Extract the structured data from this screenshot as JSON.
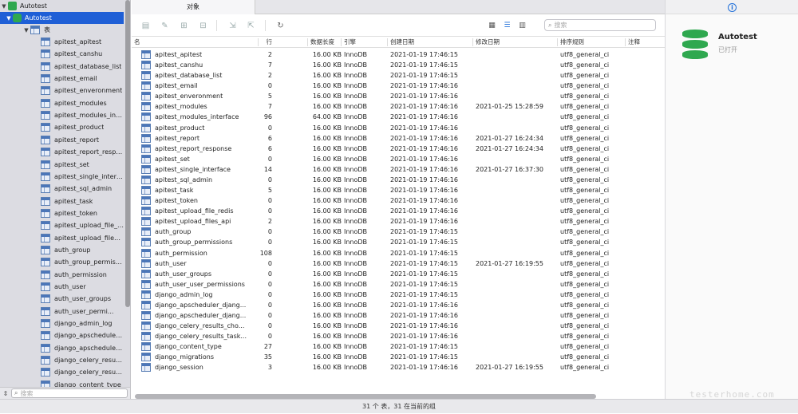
{
  "sidebar": {
    "connection": "Autotest",
    "database": "Autotest",
    "group": "表",
    "tables": [
      "apitest_apitest",
      "apitest_canshu",
      "apitest_database_list",
      "apitest_email",
      "apitest_enveronment",
      "apitest_modules",
      "apitest_modules_inter...",
      "apitest_product",
      "apitest_report",
      "apitest_report_response",
      "apitest_set",
      "apitest_single_interface",
      "apitest_sql_admin",
      "apitest_task",
      "apitest_token",
      "apitest_upload_file_re...",
      "apitest_upload_files_api",
      "auth_group",
      "auth_group_permissio...",
      "auth_permission",
      "auth_user",
      "auth_user_groups",
      "auth_user_permi...",
      "django_admin_log",
      "django_apscheduler_d...",
      "django_apscheduler_d...",
      "django_celery_results_...",
      "django_celery_results_...",
      "django_content_type"
    ],
    "search_placeholder": "搜索"
  },
  "tab": {
    "label": "对象"
  },
  "toolbar": {
    "search_placeholder": "搜索"
  },
  "columns": {
    "name": "名",
    "rows": "行",
    "size": "数据长度",
    "engine": "引擎",
    "created": "创建日期",
    "modified": "修改日期",
    "collation": "排序规则",
    "comment": "注释"
  },
  "rows": [
    {
      "name": "apitest_apitest",
      "rows": "2",
      "size": "16.00 KB",
      "engine": "InnoDB",
      "created": "2021-01-19 17:46:15",
      "modified": "",
      "collation": "utf8_general_ci"
    },
    {
      "name": "apitest_canshu",
      "rows": "7",
      "size": "16.00 KB",
      "engine": "InnoDB",
      "created": "2021-01-19 17:46:15",
      "modified": "",
      "collation": "utf8_general_ci"
    },
    {
      "name": "apitest_database_list",
      "rows": "2",
      "size": "16.00 KB",
      "engine": "InnoDB",
      "created": "2021-01-19 17:46:15",
      "modified": "",
      "collation": "utf8_general_ci"
    },
    {
      "name": "apitest_email",
      "rows": "0",
      "size": "16.00 KB",
      "engine": "InnoDB",
      "created": "2021-01-19 17:46:16",
      "modified": "",
      "collation": "utf8_general_ci"
    },
    {
      "name": "apitest_enveronment",
      "rows": "5",
      "size": "16.00 KB",
      "engine": "InnoDB",
      "created": "2021-01-19 17:46:16",
      "modified": "",
      "collation": "utf8_general_ci"
    },
    {
      "name": "apitest_modules",
      "rows": "7",
      "size": "16.00 KB",
      "engine": "InnoDB",
      "created": "2021-01-19 17:46:16",
      "modified": "2021-01-25 15:28:59",
      "collation": "utf8_general_ci"
    },
    {
      "name": "apitest_modules_interface",
      "rows": "96",
      "size": "64.00 KB",
      "engine": "InnoDB",
      "created": "2021-01-19 17:46:16",
      "modified": "",
      "collation": "utf8_general_ci"
    },
    {
      "name": "apitest_product",
      "rows": "0",
      "size": "16.00 KB",
      "engine": "InnoDB",
      "created": "2021-01-19 17:46:16",
      "modified": "",
      "collation": "utf8_general_ci"
    },
    {
      "name": "apitest_report",
      "rows": "6",
      "size": "16.00 KB",
      "engine": "InnoDB",
      "created": "2021-01-19 17:46:16",
      "modified": "2021-01-27 16:24:34",
      "collation": "utf8_general_ci"
    },
    {
      "name": "apitest_report_response",
      "rows": "6",
      "size": "16.00 KB",
      "engine": "InnoDB",
      "created": "2021-01-19 17:46:16",
      "modified": "2021-01-27 16:24:34",
      "collation": "utf8_general_ci"
    },
    {
      "name": "apitest_set",
      "rows": "0",
      "size": "16.00 KB",
      "engine": "InnoDB",
      "created": "2021-01-19 17:46:16",
      "modified": "",
      "collation": "utf8_general_ci"
    },
    {
      "name": "apitest_single_interface",
      "rows": "14",
      "size": "16.00 KB",
      "engine": "InnoDB",
      "created": "2021-01-19 17:46:16",
      "modified": "2021-01-27 16:37:30",
      "collation": "utf8_general_ci"
    },
    {
      "name": "apitest_sql_admin",
      "rows": "0",
      "size": "16.00 KB",
      "engine": "InnoDB",
      "created": "2021-01-19 17:46:16",
      "modified": "",
      "collation": "utf8_general_ci"
    },
    {
      "name": "apitest_task",
      "rows": "5",
      "size": "16.00 KB",
      "engine": "InnoDB",
      "created": "2021-01-19 17:46:16",
      "modified": "",
      "collation": "utf8_general_ci"
    },
    {
      "name": "apitest_token",
      "rows": "0",
      "size": "16.00 KB",
      "engine": "InnoDB",
      "created": "2021-01-19 17:46:16",
      "modified": "",
      "collation": "utf8_general_ci"
    },
    {
      "name": "apitest_upload_file_redis",
      "rows": "0",
      "size": "16.00 KB",
      "engine": "InnoDB",
      "created": "2021-01-19 17:46:16",
      "modified": "",
      "collation": "utf8_general_ci"
    },
    {
      "name": "apitest_upload_files_api",
      "rows": "2",
      "size": "16.00 KB",
      "engine": "InnoDB",
      "created": "2021-01-19 17:46:16",
      "modified": "",
      "collation": "utf8_general_ci"
    },
    {
      "name": "auth_group",
      "rows": "0",
      "size": "16.00 KB",
      "engine": "InnoDB",
      "created": "2021-01-19 17:46:15",
      "modified": "",
      "collation": "utf8_general_ci"
    },
    {
      "name": "auth_group_permissions",
      "rows": "0",
      "size": "16.00 KB",
      "engine": "InnoDB",
      "created": "2021-01-19 17:46:15",
      "modified": "",
      "collation": "utf8_general_ci"
    },
    {
      "name": "auth_permission",
      "rows": "108",
      "size": "16.00 KB",
      "engine": "InnoDB",
      "created": "2021-01-19 17:46:15",
      "modified": "",
      "collation": "utf8_general_ci"
    },
    {
      "name": "auth_user",
      "rows": "0",
      "size": "16.00 KB",
      "engine": "InnoDB",
      "created": "2021-01-19 17:46:15",
      "modified": "2021-01-27 16:19:55",
      "collation": "utf8_general_ci"
    },
    {
      "name": "auth_user_groups",
      "rows": "0",
      "size": "16.00 KB",
      "engine": "InnoDB",
      "created": "2021-01-19 17:46:15",
      "modified": "",
      "collation": "utf8_general_ci"
    },
    {
      "name": "auth_user_user_permissions",
      "rows": "0",
      "size": "16.00 KB",
      "engine": "InnoDB",
      "created": "2021-01-19 17:46:15",
      "modified": "",
      "collation": "utf8_general_ci"
    },
    {
      "name": "django_admin_log",
      "rows": "0",
      "size": "16.00 KB",
      "engine": "InnoDB",
      "created": "2021-01-19 17:46:15",
      "modified": "",
      "collation": "utf8_general_ci"
    },
    {
      "name": "django_apscheduler_djang...",
      "rows": "0",
      "size": "16.00 KB",
      "engine": "InnoDB",
      "created": "2021-01-19 17:46:16",
      "modified": "",
      "collation": "utf8_general_ci"
    },
    {
      "name": "django_apscheduler_djang...",
      "rows": "0",
      "size": "16.00 KB",
      "engine": "InnoDB",
      "created": "2021-01-19 17:46:16",
      "modified": "",
      "collation": "utf8_general_ci"
    },
    {
      "name": "django_celery_results_cho...",
      "rows": "0",
      "size": "16.00 KB",
      "engine": "InnoDB",
      "created": "2021-01-19 17:46:16",
      "modified": "",
      "collation": "utf8_general_ci"
    },
    {
      "name": "django_celery_results_task...",
      "rows": "0",
      "size": "16.00 KB",
      "engine": "InnoDB",
      "created": "2021-01-19 17:46:16",
      "modified": "",
      "collation": "utf8_general_ci"
    },
    {
      "name": "django_content_type",
      "rows": "27",
      "size": "16.00 KB",
      "engine": "InnoDB",
      "created": "2021-01-19 17:46:15",
      "modified": "",
      "collation": "utf8_general_ci"
    },
    {
      "name": "django_migrations",
      "rows": "35",
      "size": "16.00 KB",
      "engine": "InnoDB",
      "created": "2021-01-19 17:46:15",
      "modified": "",
      "collation": "utf8_general_ci"
    },
    {
      "name": "django_session",
      "rows": "3",
      "size": "16.00 KB",
      "engine": "InnoDB",
      "created": "2021-01-19 17:46:16",
      "modified": "2021-01-27 16:19:55",
      "collation": "utf8_general_ci"
    }
  ],
  "inspector": {
    "db_name": "Autotest",
    "db_state": "已打开"
  },
  "status": {
    "text": "31 个 表，31 在当前的组"
  },
  "watermark": "testerhome.com",
  "colors": {
    "accent": "#1f5fd6",
    "db_green": "#2fa84f"
  },
  "icons": {
    "connection": "connection-icon",
    "database": "database-icon",
    "table": "table-icon",
    "info": "info-icon"
  }
}
